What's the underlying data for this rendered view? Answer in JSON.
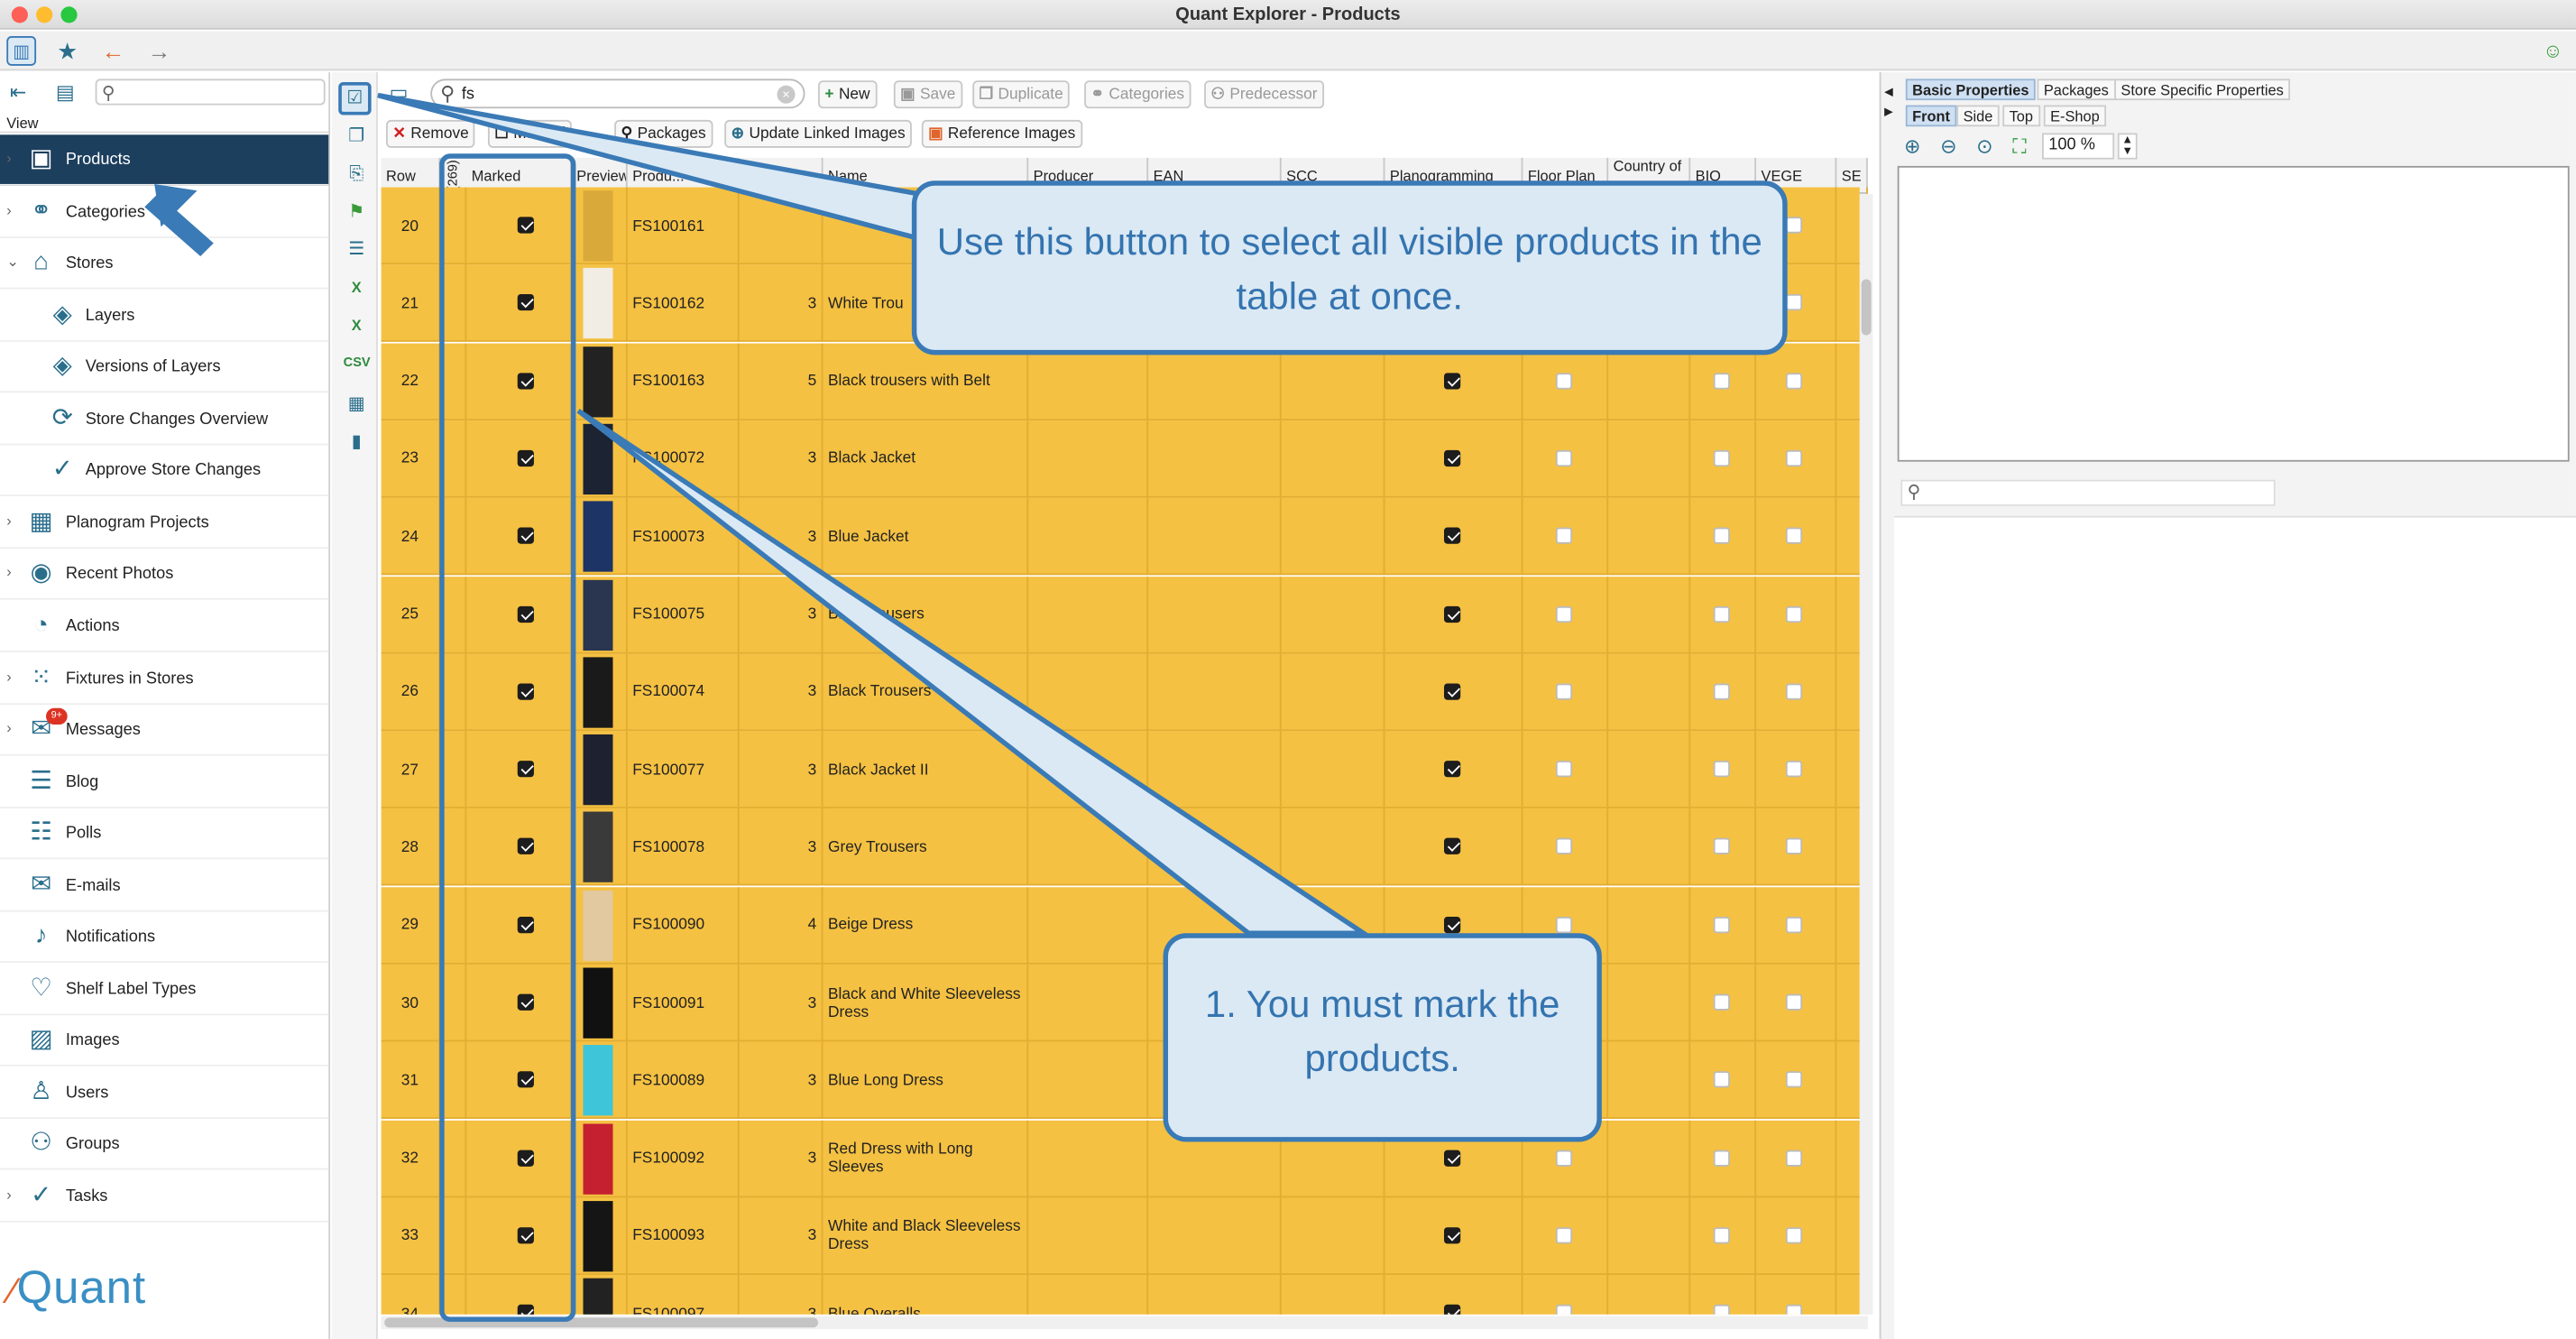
{
  "window": {
    "title": "Quant Explorer - Products"
  },
  "sidebar": {
    "view_label": "View",
    "items": [
      {
        "label": "Products",
        "icon": "products-icon",
        "glyph": "▣",
        "chevron": "›",
        "selected": true
      },
      {
        "label": "Categories",
        "icon": "categories-icon",
        "glyph": "⚭",
        "chevron": "›"
      },
      {
        "label": "Stores",
        "icon": "stores-icon",
        "glyph": "⌂",
        "chevron": "⌄"
      },
      {
        "label": "Layers",
        "icon": "layers-icon",
        "glyph": "◈",
        "child": true
      },
      {
        "label": "Versions of Layers",
        "icon": "versions-icon",
        "glyph": "◈",
        "child": true
      },
      {
        "label": "Store Changes Overview",
        "icon": "store-changes-icon",
        "glyph": "⟳",
        "child": true
      },
      {
        "label": "Approve Store Changes",
        "icon": "approve-icon",
        "glyph": "✓",
        "child": true
      },
      {
        "label": "Planogram Projects",
        "icon": "planogram-icon",
        "glyph": "▦",
        "chevron": "›"
      },
      {
        "label": "Recent Photos",
        "icon": "camera-icon",
        "glyph": "◉",
        "chevron": "›"
      },
      {
        "label": "Actions",
        "icon": "actions-icon",
        "glyph": "◔"
      },
      {
        "label": "Fixtures in Stores",
        "icon": "fixtures-icon",
        "glyph": "⁙",
        "chevron": "›"
      },
      {
        "label": "Messages",
        "icon": "messages-icon",
        "glyph": "✉",
        "chevron": "›",
        "badge": "9+"
      },
      {
        "label": "Blog",
        "icon": "blog-icon",
        "glyph": "☰"
      },
      {
        "label": "Polls",
        "icon": "polls-icon",
        "glyph": "☷"
      },
      {
        "label": "E-mails",
        "icon": "email-icon",
        "glyph": "✉"
      },
      {
        "label": "Notifications",
        "icon": "bell-icon",
        "glyph": "♪"
      },
      {
        "label": "Shelf Label Types",
        "icon": "label-icon",
        "glyph": "♡"
      },
      {
        "label": "Images",
        "icon": "image-icon",
        "glyph": "▨"
      },
      {
        "label": "Users",
        "icon": "user-icon",
        "glyph": "♙"
      },
      {
        "label": "Groups",
        "icon": "groups-icon",
        "glyph": "⚇"
      },
      {
        "label": "Tasks",
        "icon": "tasks-icon",
        "glyph": "✓",
        "chevron": "›"
      }
    ],
    "logo": "Quant"
  },
  "toolbar": {
    "search_value": "fs",
    "new": "New",
    "save": "Save",
    "duplicate": "Duplicate",
    "categories": "Categories",
    "predecessor": "Predecessor",
    "remove": "Remove",
    "marked": "Marked",
    "packages": "Packages",
    "update_linked_images": "Update Linked Images",
    "reference_images": "Reference Images"
  },
  "grid": {
    "columns": [
      "Row",
      "(269)",
      "Marked",
      "Preview",
      "Produ...",
      "Version",
      "Name",
      "Producer",
      "EAN",
      "SCC",
      "Planogramming",
      "Floor Plan",
      "Country of",
      "BIO",
      "VEGE",
      "SE"
    ],
    "rows": [
      {
        "row": "20",
        "code": "FS100161",
        "version": "",
        "name": "",
        "plano": false,
        "color": "#d9a93a"
      },
      {
        "row": "21",
        "code": "FS100162",
        "version": "3",
        "name": "White Trou",
        "plano": false,
        "color": "#f1ede4"
      },
      {
        "row": "22",
        "code": "FS100163",
        "version": "5",
        "name": "Black trousers with Belt",
        "plano": true,
        "color": "#222222"
      },
      {
        "row": "23",
        "code": "FS100072",
        "version": "3",
        "name": "Black Jacket",
        "plano": true,
        "color": "#1c2333"
      },
      {
        "row": "24",
        "code": "FS100073",
        "version": "3",
        "name": "Blue Jacket",
        "plano": true,
        "color": "#1d3566"
      },
      {
        "row": "25",
        "code": "FS100075",
        "version": "3",
        "name": "Blue Trousers",
        "plano": true,
        "color": "#2a3550"
      },
      {
        "row": "26",
        "code": "FS100074",
        "version": "3",
        "name": "Black Trousers",
        "plano": true,
        "color": "#1a1a1a"
      },
      {
        "row": "27",
        "code": "FS100077",
        "version": "3",
        "name": "Black Jacket II",
        "plano": true,
        "color": "#1e2230"
      },
      {
        "row": "28",
        "code": "FS100078",
        "version": "3",
        "name": "Grey Trousers",
        "plano": true,
        "color": "#3a3a3a"
      },
      {
        "row": "29",
        "code": "FS100090",
        "version": "4",
        "name": "Beige Dress",
        "plano": true,
        "color": "#e2c9a0"
      },
      {
        "row": "30",
        "code": "FS100091",
        "version": "3",
        "name": "Black and White Sleeveless Dress",
        "plano": false,
        "color": "#111111"
      },
      {
        "row": "31",
        "code": "FS100089",
        "version": "3",
        "name": "Blue Long Dress",
        "plano": false,
        "color": "#3ec5d9"
      },
      {
        "row": "32",
        "code": "FS100092",
        "version": "3",
        "name": "Red Dress with Long Sleeves",
        "plano": true,
        "color": "#c42030"
      },
      {
        "row": "33",
        "code": "FS100093",
        "version": "3",
        "name": "White and Black Sleeveless Dress",
        "plano": true,
        "color": "#151515"
      },
      {
        "row": "34",
        "code": "FS100097",
        "version": "3",
        "name": "Blue Overalls",
        "plano": true,
        "color": "#222222"
      }
    ]
  },
  "right_panel": {
    "tabs": [
      "Basic Properties",
      "Packages",
      "Store Specific Properties"
    ],
    "view_tabs": [
      "Front",
      "Side",
      "Top",
      "E-Shop"
    ],
    "zoom": "100 %"
  },
  "callouts": {
    "select_all": "Use this button to select all visible products in the table at once.",
    "mark": "1. You must mark the products."
  },
  "colors": {
    "row_marked": "#f5c142",
    "selected_nav": "#1d3f5e",
    "callout_border": "#3a7ab6",
    "callout_fill": "#dbe9f4"
  }
}
